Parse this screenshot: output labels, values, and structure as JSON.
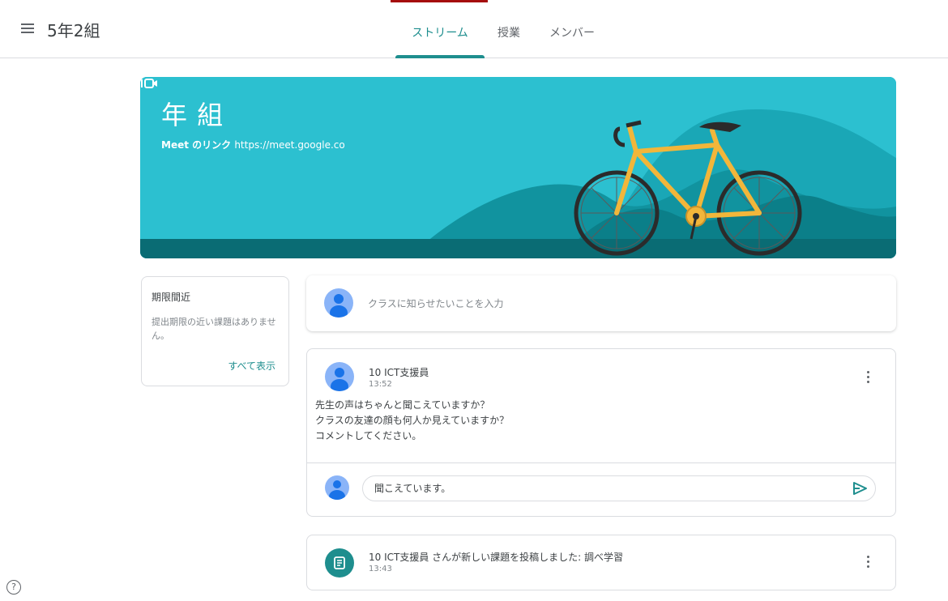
{
  "header": {
    "class_name": "5年2組",
    "tabs": [
      {
        "label": "ストリーム"
      },
      {
        "label": "授業"
      },
      {
        "label": "メンバー"
      }
    ]
  },
  "banner": {
    "title": "  年  組",
    "meet_label": "Meet のリンク",
    "meet_link": "https://meet.google.co",
    "colors": {
      "background": "#2cc0d0",
      "accent": "#1e8e8e"
    }
  },
  "upcoming": {
    "title": "期限間近",
    "text": "提出期限の近い課題はありません。",
    "view_all": "すべて表示"
  },
  "announce": {
    "placeholder": "クラスに知らせたいことを入力"
  },
  "post": {
    "author": "10 ICT支援員",
    "time": "13:52",
    "lines": [
      "先生の声はちゃんと聞こえていますか？",
      "クラスの友達の顔も何人か見えていますか？",
      "コメントしてください。"
    ],
    "comment_value": "聞こえています。"
  },
  "assignment": {
    "title": "10 ICT支援員 さんが新しい課題を投稿しました: 調べ学習",
    "time": "13:43"
  },
  "help": {
    "label": "?"
  }
}
